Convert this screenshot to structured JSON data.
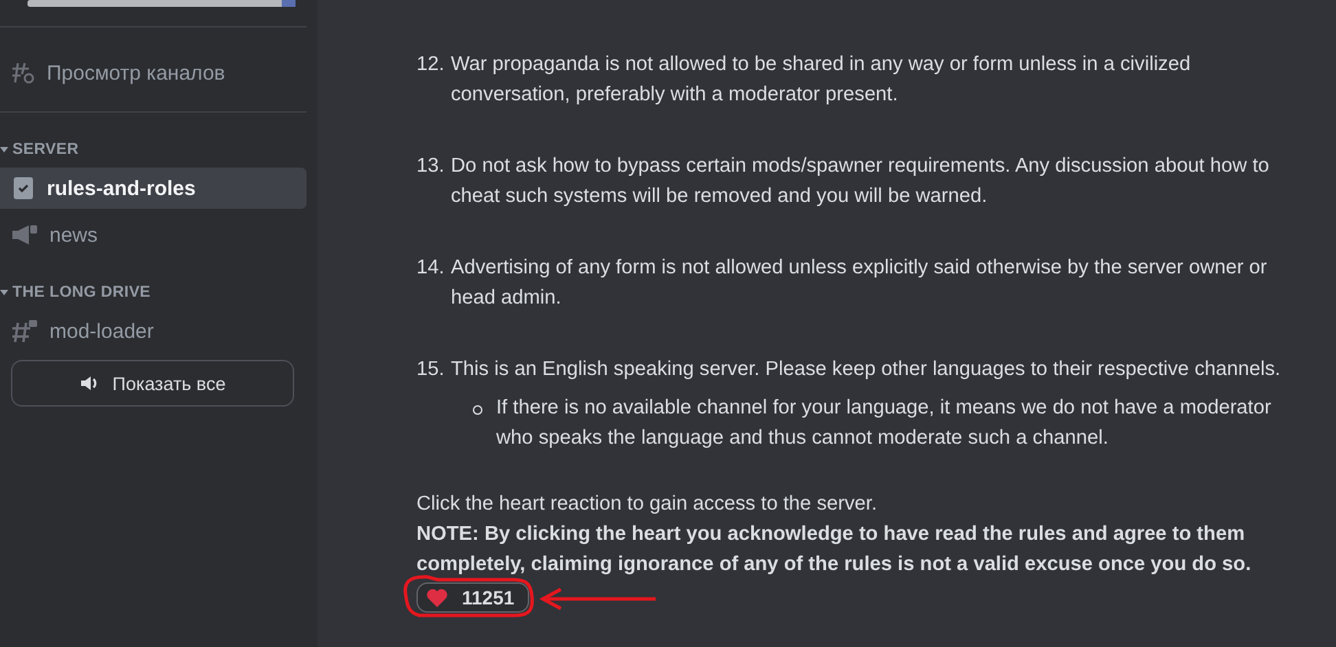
{
  "sidebar": {
    "browse": {
      "label": "Просмотр каналов"
    },
    "categories": [
      {
        "name": "SERVER",
        "expanded": true,
        "channels": [
          {
            "name": "rules-and-roles",
            "kind": "rules",
            "selected": true
          },
          {
            "name": "news",
            "kind": "announcement",
            "selected": false
          }
        ]
      },
      {
        "name": "THE LONG DRIVE",
        "expanded": true,
        "channels": [
          {
            "name": "mod-loader",
            "kind": "locked-text",
            "selected": false
          }
        ]
      }
    ],
    "show_all_button": "Показать все"
  },
  "message": {
    "rules": [
      {
        "number": "12.",
        "text": "War propaganda is not allowed to be shared in any way or form unless in a civilized conversation, preferably with a moderator present."
      },
      {
        "number": "13.",
        "text": "Do not ask how to bypass certain mods/spawner requirements. Any discussion about how to cheat such systems will be removed and you will be warned."
      },
      {
        "number": "14.",
        "text": "Advertising of any form is not allowed unless explicitly said otherwise by the server owner or head admin."
      },
      {
        "number": "15.",
        "text": "This is an English speaking server. Please keep other languages to their respective channels.",
        "subitems": [
          "If there is no available channel for your language, it means we do not have a moderator who speaks the language and thus cannot moderate such a channel."
        ]
      }
    ],
    "instruction": "Click the heart reaction to gain access to the server.",
    "note": "**NOTE: By clicking the heart you acknowledge to have read the rules and agree to them completely, claiming ignorance of any of the rules is not a valid excuse once you do so.**",
    "reaction": {
      "count": "11251",
      "reacted": false
    }
  }
}
